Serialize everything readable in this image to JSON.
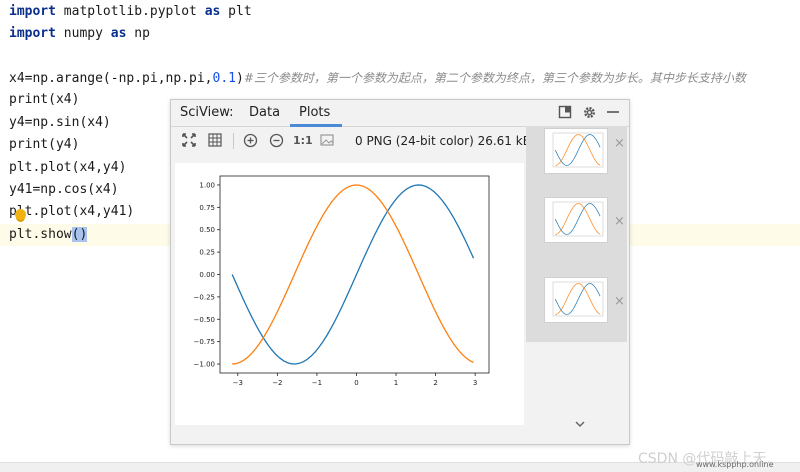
{
  "editor": {
    "lines": [
      {
        "kw1": "import",
        "plain": " matplotlib.pyplot ",
        "kw2": "as",
        "tail": " plt"
      },
      {
        "kw1": "import",
        "plain": " numpy ",
        "kw2": "as",
        "tail": " np"
      },
      {
        "pre": "x4=np.arange(-np.pi,np.pi,",
        "num": "0.1",
        "post": ")",
        "comment": "#三个参数时，第一个参数为起点，第二个参数为终点，第三个参数为步长。其中步长支持小数"
      },
      {
        "text": "print(x4)"
      },
      {
        "text": "y4=np.sin(x4)"
      },
      {
        "text": "print(y4)"
      },
      {
        "text": "plt.plot(x4,y4)"
      },
      {
        "text": "y41=np.cos(x4)"
      },
      {
        "text": "plt.plot(x4,y41)"
      },
      {
        "pre": "plt.show",
        "sel": "()"
      }
    ]
  },
  "sciview": {
    "title": "SciView:",
    "tabs": [
      {
        "label": "Data"
      },
      {
        "label": "Plots",
        "active": true
      }
    ],
    "header_icons": [
      "maximize-icon",
      "gear-icon",
      "minimize-icon"
    ],
    "toolbar_icons": [
      "fit-icon",
      "grid-icon",
      "zoom-in-icon",
      "zoom-out-icon",
      "actual-size-icon",
      "image-icon"
    ],
    "actual_size_label": "1:1",
    "image_info": "0 PNG (24-bit color) 26.61 kB",
    "thumbnail_count": 3,
    "thumbnail_close_label": "×"
  },
  "chart_data": {
    "type": "line",
    "series": [
      {
        "values_fn": "sin",
        "color": "#1f77b4"
      },
      {
        "values_fn": "cos",
        "color": "#ff7f0e"
      }
    ],
    "x_range": [
      -3.14159,
      3.04159
    ],
    "x_step": 0.1,
    "xlim": [
      -3.45,
      3.35
    ],
    "ylim": [
      -1.1,
      1.1
    ],
    "xticks": [
      "−3",
      "−2",
      "−1",
      "0",
      "1",
      "2",
      "3"
    ],
    "yticks": [
      "1.00",
      "0.75",
      "0.50",
      "0.25",
      "0.00",
      "−0.25",
      "−0.50",
      "−0.75",
      "−1.00"
    ],
    "title": "",
    "xlabel": "",
    "ylabel": ""
  },
  "watermark": {
    "text": "CSDN @代码敲上天.",
    "site": "www.kspphp.online"
  }
}
